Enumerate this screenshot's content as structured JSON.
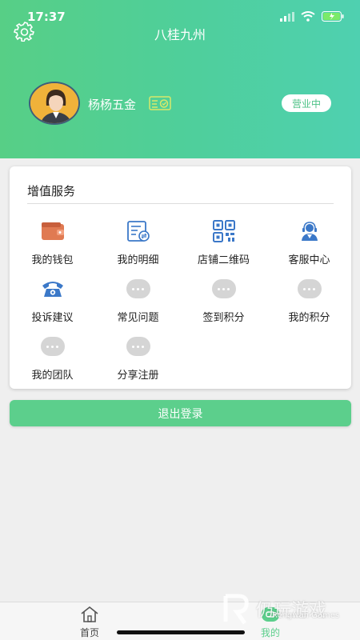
{
  "status_bar": {
    "time": "17:37"
  },
  "header": {
    "title": "八桂九州",
    "username": "杨杨五金",
    "status_label": "营业中"
  },
  "services": {
    "title": "增值服务",
    "items": [
      {
        "label": "我的钱包",
        "icon": "wallet-icon"
      },
      {
        "label": "我的明细",
        "icon": "statement-icon"
      },
      {
        "label": "店铺二维码",
        "icon": "qr-code-icon"
      },
      {
        "label": "客服中心",
        "icon": "customer-service-icon"
      },
      {
        "label": "投诉建议",
        "icon": "phone-icon"
      },
      {
        "label": "常见问题",
        "icon": "more-dots-icon"
      },
      {
        "label": "签到积分",
        "icon": "more-dots-icon"
      },
      {
        "label": "我的积分",
        "icon": "more-dots-icon"
      },
      {
        "label": "我的团队",
        "icon": "more-dots-icon"
      },
      {
        "label": "分享注册",
        "icon": "more-dots-icon"
      }
    ]
  },
  "logout_label": "退出登录",
  "tabbar": {
    "tabs": [
      {
        "label": "首页",
        "color": "#444444"
      },
      {
        "label": "我的",
        "color": "#5ccf8c"
      }
    ]
  },
  "watermark": {
    "text": "仍玩游戏",
    "sub": "Rengwan Games"
  },
  "colors": {
    "accent": "#5ccf8c",
    "header_start": "#57cf86",
    "header_end": "#4fd0b0"
  }
}
